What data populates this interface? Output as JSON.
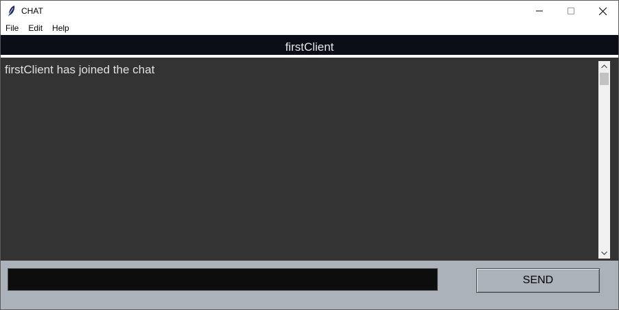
{
  "window": {
    "title": "CHAT",
    "icon": "feather-icon"
  },
  "menubar": {
    "items": [
      {
        "label": "File"
      },
      {
        "label": "Edit"
      },
      {
        "label": "Help"
      }
    ]
  },
  "header": {
    "title": "firstClient"
  },
  "chat": {
    "messages": [
      {
        "text": "firstClient has joined the chat"
      }
    ]
  },
  "composer": {
    "input_value": "",
    "send_label": "SEND"
  },
  "colors": {
    "header_bg": "#0b0e17",
    "chat_bg": "#333333",
    "bottom_bg": "#abb2b9",
    "input_bg": "#0d0d0d"
  }
}
